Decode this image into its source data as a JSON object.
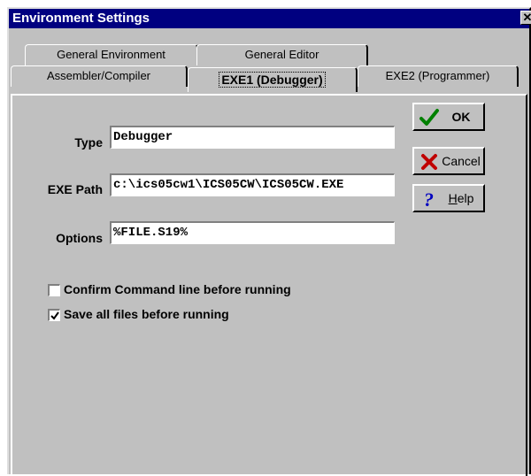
{
  "window": {
    "title": "Environment Settings",
    "close_label": "✕"
  },
  "tabs": {
    "row1": [
      {
        "label": "General Environment"
      },
      {
        "label": "General Editor"
      }
    ],
    "row2": [
      {
        "label": "Assembler/Compiler"
      },
      {
        "label": "EXE1 (Debugger)"
      },
      {
        "label": "EXE2 (Programmer)"
      }
    ],
    "active": "EXE1 (Debugger)"
  },
  "form": {
    "type": {
      "label": "Type",
      "value": "Debugger"
    },
    "exe_path": {
      "label": "EXE Path",
      "value": "c:\\ics05cw1\\ICS05CW\\ICS05CW.EXE"
    },
    "options": {
      "label": "Options",
      "value": "%FILE.S19%"
    }
  },
  "checkboxes": [
    {
      "label": "Confirm Command line before running",
      "checked": false
    },
    {
      "label": "Save all files before running",
      "checked": true
    }
  ],
  "buttons": {
    "ok": {
      "label": "OK",
      "icon": "check-icon"
    },
    "cancel": {
      "label": "Cancel",
      "icon": "x-icon"
    },
    "help": {
      "label_underlined": "H",
      "label_rest": "elp",
      "icon": "question-icon"
    }
  },
  "colors": {
    "title_bar": "#000080",
    "face": "#c0c0c0",
    "ok_check": "#008000",
    "cancel_x": "#c00000",
    "help_q": "#0000c0"
  }
}
